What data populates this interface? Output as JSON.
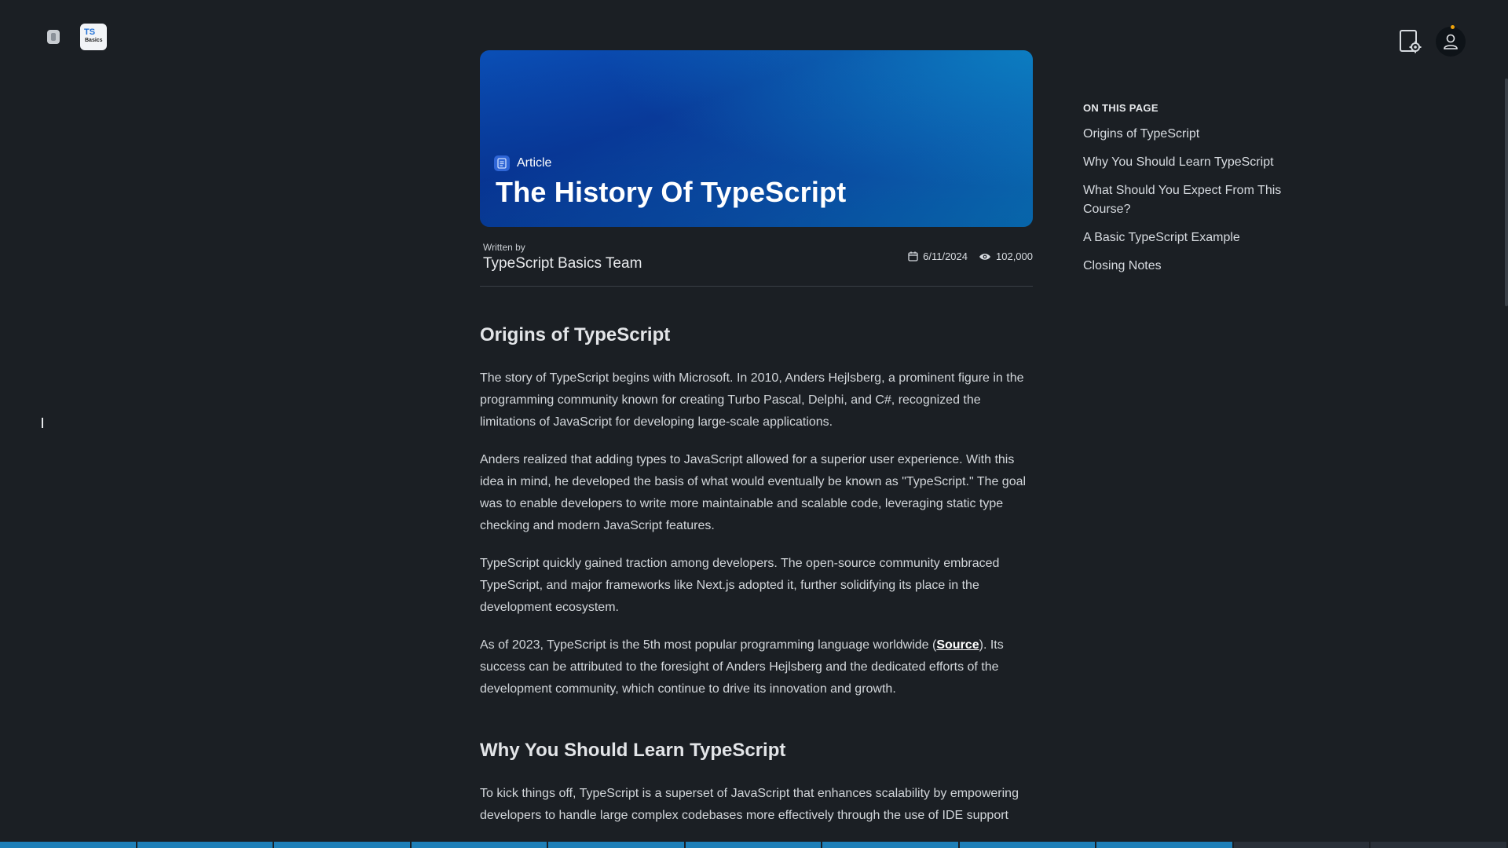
{
  "app": {
    "logo_text_top": "TS",
    "logo_text_bottom": "Basics"
  },
  "hero": {
    "tag": "Article",
    "title": "The History Of TypeScript"
  },
  "byline": {
    "written_by_label": "Written by",
    "author": "TypeScript Basics Team",
    "date": "6/11/2024",
    "views": "102,000"
  },
  "article": {
    "section1": {
      "heading": "Origins of TypeScript",
      "p1": "The story of TypeScript begins with Microsoft. In 2010, Anders Hejlsberg, a prominent figure in the programming community known for creating Turbo Pascal, Delphi, and C#, recognized the limitations of JavaScript for developing large-scale applications.",
      "p2": "Anders realized that adding types to JavaScript allowed for a superior user experience. With this idea in mind, he developed the basis of what would eventually be known as \"TypeScript.\" The goal was to enable developers to write more maintainable and scalable code, leveraging static type checking and modern JavaScript features.",
      "p3": "TypeScript quickly gained traction among developers. The open-source community embraced TypeScript, and major frameworks like Next.js adopted it, further solidifying its place in the development ecosystem.",
      "p4_before": "As of 2023, TypeScript is the 5th most popular programming language worldwide (",
      "p4_link": "Source",
      "p4_after": "). Its success can be attributed to the foresight of Anders Hejlsberg and the dedicated efforts of the development community, which continue to drive its innovation and growth."
    },
    "section2": {
      "heading": "Why You Should Learn TypeScript",
      "p1": "To kick things off, TypeScript is a superset of JavaScript that enhances scalability by empowering developers to handle large complex codebases more effectively through the use of IDE support"
    }
  },
  "toc": {
    "heading": "ON THIS PAGE",
    "items": [
      "Origins of TypeScript",
      "Why You Should Learn TypeScript",
      "What Should You Expect From This Course?",
      "A Basic TypeScript Example",
      "Closing Notes"
    ]
  },
  "reading_progress": {
    "segments_total": 11,
    "segments_filled": 9
  },
  "colors": {
    "background": "#1b1f24",
    "hero_gradient_start": "#0a4fb6",
    "hero_gradient_end": "#0b8ec9",
    "progress": "#1e7fb8",
    "notification_dot": "#f0a30a"
  },
  "icons": [
    "panel-icon",
    "app-logo",
    "settings-page-icon",
    "user-icon",
    "article-icon",
    "calendar-icon",
    "eye-icon"
  ]
}
